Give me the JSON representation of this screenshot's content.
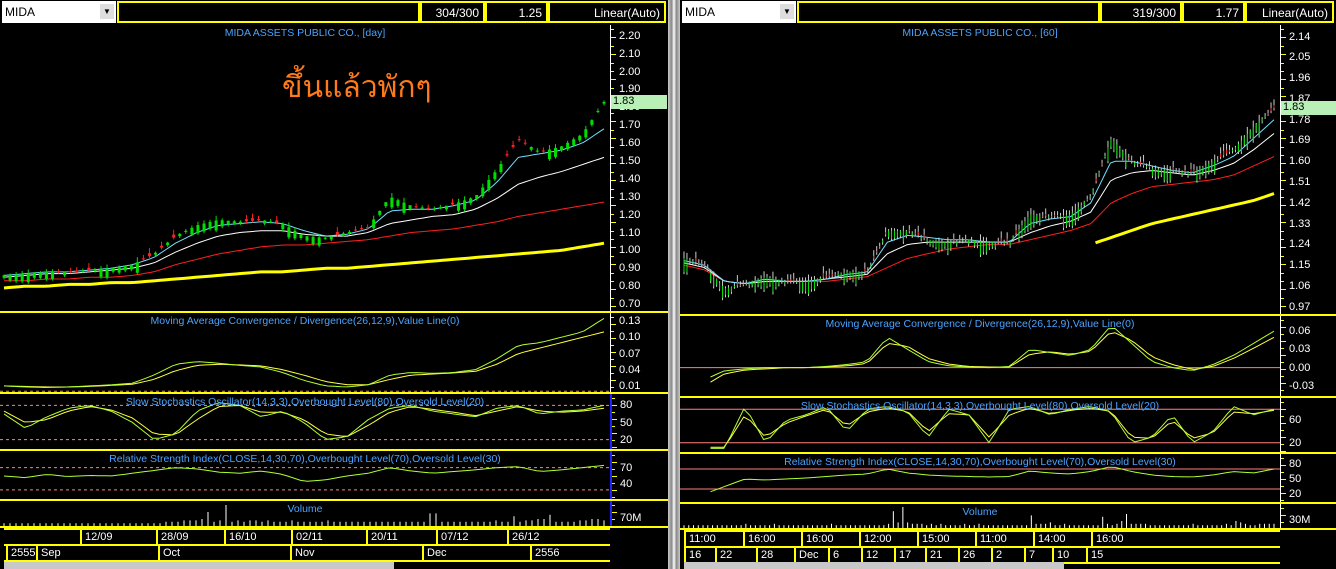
{
  "colors": {
    "grid": "#ffff00",
    "title": "#4aa3ff",
    "up": "#00e000",
    "down": "#ff2020",
    "ema1": "#ffff00",
    "ema2": "#ff2020",
    "ema3": "#ffffff",
    "ema4": "#70e0ff",
    "osc": "#b0ff30",
    "sig": "#ffff40",
    "level": "#ff8080"
  },
  "left": {
    "symbol": "MIDA",
    "counter": "304/300",
    "scale_value": "1.25",
    "scale_mode": "Linear(Auto)",
    "annotation": "ขึ้นแล้วพักๆ",
    "price": {
      "title": "MIDA ASSETS PUBLIC CO., [day]",
      "ylim": [
        0.65,
        2.26
      ],
      "ticks": [
        "2.20",
        "2.10",
        "2.00",
        "1.90",
        "1.80",
        "1.70",
        "1.60",
        "1.50",
        "1.40",
        "1.30",
        "1.20",
        "1.10",
        "1.00",
        "0.90",
        "0.80",
        "0.70"
      ],
      "last": "1.83",
      "close": [
        0.86,
        0.87,
        0.88,
        0.88,
        0.89,
        0.9,
        0.92,
        0.98,
        1.08,
        1.14,
        1.17,
        1.16,
        1.17,
        1.15,
        1.08,
        1.07,
        1.1,
        1.13,
        1.3,
        1.25,
        1.23,
        1.26,
        1.3,
        1.45,
        1.62,
        1.55,
        1.58,
        1.65,
        1.83
      ],
      "ma": [
        [
          0.86,
          0.87,
          0.88,
          0.88,
          0.89,
          0.9,
          0.92,
          0.96,
          1.04,
          1.1,
          1.14,
          1.15,
          1.16,
          1.15,
          1.11,
          1.08,
          1.09,
          1.12,
          1.22,
          1.23,
          1.23,
          1.25,
          1.28,
          1.38,
          1.52,
          1.54,
          1.56,
          1.6,
          1.68
        ],
        [
          0.85,
          0.86,
          0.87,
          0.87,
          0.88,
          0.89,
          0.9,
          0.93,
          0.99,
          1.04,
          1.08,
          1.1,
          1.11,
          1.11,
          1.09,
          1.08,
          1.08,
          1.1,
          1.15,
          1.17,
          1.19,
          1.2,
          1.23,
          1.29,
          1.37,
          1.41,
          1.44,
          1.48,
          1.52
        ],
        [
          0.83,
          0.83,
          0.84,
          0.84,
          0.85,
          0.85,
          0.86,
          0.88,
          0.92,
          0.95,
          0.98,
          1.0,
          1.02,
          1.03,
          1.03,
          1.04,
          1.05,
          1.06,
          1.08,
          1.1,
          1.11,
          1.12,
          1.14,
          1.16,
          1.19,
          1.21,
          1.23,
          1.25,
          1.27
        ],
        [
          0.79,
          0.8,
          0.8,
          0.81,
          0.81,
          0.82,
          0.82,
          0.83,
          0.84,
          0.85,
          0.86,
          0.87,
          0.88,
          0.88,
          0.89,
          0.9,
          0.9,
          0.91,
          0.92,
          0.93,
          0.94,
          0.95,
          0.96,
          0.97,
          0.98,
          0.99,
          1.0,
          1.02,
          1.04
        ]
      ]
    },
    "macd": {
      "title": "Moving Average Convergence / Divergence(26,12,9),Value Line(0)",
      "ylim": [
        -0.005,
        0.145
      ],
      "ticks": [
        "0.13",
        "0.10",
        "0.07",
        "0.04",
        "0.01"
      ],
      "zero": 0,
      "line": [
        0.01,
        0.008,
        0.007,
        0.008,
        0.01,
        0.012,
        0.015,
        0.03,
        0.05,
        0.055,
        0.052,
        0.048,
        0.045,
        0.035,
        0.02,
        0.01,
        0.008,
        0.012,
        0.03,
        0.035,
        0.033,
        0.035,
        0.04,
        0.06,
        0.085,
        0.09,
        0.1,
        0.11,
        0.135
      ],
      "signal": [
        0.01,
        0.009,
        0.008,
        0.008,
        0.009,
        0.011,
        0.013,
        0.022,
        0.038,
        0.048,
        0.05,
        0.049,
        0.047,
        0.04,
        0.03,
        0.018,
        0.012,
        0.012,
        0.022,
        0.03,
        0.032,
        0.034,
        0.037,
        0.05,
        0.07,
        0.08,
        0.09,
        0.1,
        0.11
      ]
    },
    "stoch": {
      "title": "Slow Stochastics Oscillator(14,3,3),Overbought Level(80),Oversold Level(20)",
      "ylim": [
        0,
        100
      ],
      "ticks": [
        "80",
        "50",
        "20"
      ],
      "levels": [
        80,
        20
      ],
      "k": [
        65,
        40,
        60,
        75,
        80,
        70,
        50,
        20,
        30,
        70,
        85,
        80,
        60,
        70,
        50,
        20,
        25,
        55,
        75,
        80,
        70,
        65,
        60,
        75,
        80,
        65,
        70,
        72,
        80
      ],
      "d": [
        70,
        50,
        55,
        70,
        78,
        72,
        58,
        30,
        28,
        55,
        78,
        80,
        68,
        68,
        55,
        30,
        25,
        45,
        68,
        78,
        73,
        68,
        62,
        70,
        78,
        70,
        68,
        70,
        75
      ]
    },
    "rsi": {
      "title": "Relative Strength Index(CLOSE,14,30,70),Overbought Level(70),Oversold Level(30)",
      "ylim": [
        10,
        100
      ],
      "ticks": [
        "70",
        "40"
      ],
      "levels": [
        70,
        30
      ],
      "line": [
        55,
        52,
        58,
        54,
        56,
        55,
        60,
        65,
        70,
        68,
        62,
        60,
        64,
        58,
        45,
        48,
        55,
        60,
        70,
        64,
        60,
        63,
        66,
        70,
        72,
        63,
        66,
        70,
        74
      ]
    },
    "volume": {
      "title": "Volume",
      "ticks": [
        "70M"
      ],
      "bars": [
        2,
        2,
        2,
        2,
        2,
        2,
        2,
        2,
        2,
        2,
        2,
        2,
        2,
        2,
        2,
        2,
        2,
        2,
        2,
        2,
        2,
        2,
        2,
        2,
        2,
        2,
        2,
        3,
        3,
        3,
        4,
        4,
        4,
        5,
        10,
        3,
        4,
        15,
        3,
        4,
        3,
        4,
        4,
        3,
        4,
        3,
        3,
        3,
        4,
        3,
        3,
        3,
        3,
        3,
        4,
        3,
        3,
        3,
        3,
        3,
        3,
        3,
        3,
        3,
        3,
        3,
        3,
        3,
        3,
        3,
        3,
        9,
        9,
        3,
        3,
        3,
        3,
        3,
        3,
        3,
        3,
        3,
        4,
        3,
        3,
        7,
        3,
        4,
        4,
        5,
        5,
        8,
        3,
        3,
        3,
        3,
        4,
        4,
        5,
        5,
        4
      ]
    },
    "dates": [
      "12/09",
      "28/09",
      "16/10",
      "02/11",
      "20/11",
      "07/12",
      "26/12"
    ],
    "months": [
      "2555",
      "Sep",
      "Oct",
      "Nov",
      "Dec",
      "2556"
    ]
  },
  "right": {
    "symbol": "MIDA",
    "counter": "319/300",
    "scale_value": "1.77",
    "scale_mode": "Linear(Auto)",
    "price": {
      "title": "MIDA ASSETS PUBLIC CO., [60]",
      "ylim": [
        0.93,
        2.19
      ],
      "ticks": [
        "2.14",
        "2.05",
        "1.96",
        "1.87",
        "1.78",
        "1.69",
        "1.60",
        "1.51",
        "1.42",
        "1.33",
        "1.24",
        "1.15",
        "1.06",
        "0.97"
      ],
      "last": "1.83",
      "close": [
        1.18,
        1.15,
        1.05,
        1.07,
        1.1,
        1.08,
        1.08,
        1.1,
        1.12,
        1.12,
        1.3,
        1.3,
        1.26,
        1.25,
        1.26,
        1.25,
        1.25,
        1.37,
        1.36,
        1.37,
        1.45,
        1.7,
        1.6,
        1.57,
        1.56,
        1.55,
        1.6,
        1.65,
        1.75,
        1.83
      ],
      "ma": [
        [
          1.17,
          1.15,
          1.08,
          1.07,
          1.09,
          1.08,
          1.08,
          1.09,
          1.11,
          1.12,
          1.25,
          1.28,
          1.27,
          1.26,
          1.26,
          1.25,
          1.25,
          1.33,
          1.35,
          1.36,
          1.42,
          1.6,
          1.6,
          1.58,
          1.56,
          1.55,
          1.58,
          1.62,
          1.7,
          1.78
        ],
        [
          1.16,
          1.14,
          1.08,
          1.07,
          1.08,
          1.08,
          1.08,
          1.09,
          1.1,
          1.11,
          1.2,
          1.24,
          1.25,
          1.25,
          1.25,
          1.25,
          1.25,
          1.29,
          1.32,
          1.34,
          1.38,
          1.52,
          1.55,
          1.56,
          1.55,
          1.54,
          1.56,
          1.59,
          1.65,
          1.72
        ],
        [
          1.15,
          1.13,
          1.08,
          1.07,
          1.08,
          1.08,
          1.08,
          1.08,
          1.09,
          1.1,
          1.14,
          1.18,
          1.2,
          1.22,
          1.23,
          1.24,
          1.24,
          1.26,
          1.28,
          1.3,
          1.33,
          1.42,
          1.46,
          1.49,
          1.5,
          1.51,
          1.52,
          1.54,
          1.58,
          1.62
        ],
        [
          null,
          null,
          null,
          null,
          null,
          null,
          null,
          null,
          null,
          null,
          null,
          null,
          null,
          null,
          null,
          null,
          null,
          null,
          null,
          null,
          1.24,
          1.27,
          1.3,
          1.33,
          1.35,
          1.37,
          1.39,
          1.41,
          1.43,
          1.46
        ]
      ]
    },
    "macd": {
      "title": "Moving Average Convergence / Divergence(26,12,9),Value Line(0)",
      "ylim": [
        -0.05,
        0.085
      ],
      "ticks": [
        "0.06",
        "0.03",
        "0.00",
        "-0.03"
      ],
      "zero": 0,
      "line": [
        null,
        -0.02,
        -0.005,
        -0.002,
        0,
        0,
        0,
        0.002,
        0.005,
        0.01,
        0.05,
        0.03,
        0.01,
        0.003,
        0.001,
        0,
        0.002,
        0.03,
        0.025,
        0.02,
        0.03,
        0.07,
        0.04,
        0.01,
        0.0,
        -0.005,
        0.005,
        0.02,
        0.04,
        0.06
      ],
      "signal": [
        null,
        -0.03,
        -0.01,
        -0.004,
        -0.002,
        0,
        0,
        0.001,
        0.003,
        0.007,
        0.04,
        0.035,
        0.015,
        0.006,
        0.002,
        0.001,
        0.001,
        0.022,
        0.026,
        0.022,
        0.027,
        0.06,
        0.045,
        0.018,
        0.005,
        -0.003,
        0.002,
        0.015,
        0.032,
        0.05
      ]
    },
    "stoch": {
      "title": "Slow Stochastics Oscillator(14,3,3),Overbought Level(80),Oversold Level(20)",
      "ylim": [
        0,
        100
      ],
      "ticks": [
        "60",
        "20"
      ],
      "levels": [
        80,
        20
      ],
      "k": [
        null,
        10,
        10,
        85,
        20,
        60,
        70,
        85,
        40,
        80,
        85,
        75,
        30,
        80,
        70,
        20,
        80,
        85,
        70,
        80,
        85,
        75,
        20,
        30,
        70,
        20,
        40,
        85,
        70,
        80
      ],
      "d": [
        null,
        12,
        12,
        70,
        30,
        55,
        68,
        80,
        50,
        75,
        82,
        76,
        40,
        72,
        70,
        30,
        70,
        82,
        72,
        78,
        82,
        76,
        30,
        28,
        60,
        28,
        38,
        75,
        72,
        78
      ]
    },
    "rsi": {
      "title": "Relative Strength Index(CLOSE,14,30,70),Overbought Level(70),Oversold Level(30)",
      "ylim": [
        0,
        100
      ],
      "ticks": [
        "80",
        "50",
        "20"
      ],
      "levels": [
        70,
        30
      ],
      "line": [
        null,
        20,
        35,
        50,
        48,
        50,
        52,
        55,
        58,
        60,
        70,
        62,
        58,
        56,
        55,
        54,
        55,
        66,
        62,
        60,
        65,
        75,
        65,
        58,
        55,
        54,
        58,
        65,
        62,
        70
      ]
    },
    "volume": {
      "title": "Volume",
      "ticks": [
        "30M"
      ],
      "bars": [
        2,
        2,
        2,
        2,
        2,
        2,
        2,
        2,
        2,
        2,
        2,
        2,
        2,
        3,
        2,
        2,
        2,
        2,
        2,
        3,
        2,
        2,
        2,
        2,
        2,
        2,
        2,
        2,
        2,
        2,
        2,
        3,
        2,
        2,
        2,
        2,
        2,
        2,
        2,
        2,
        2,
        2,
        2,
        3,
        12,
        4,
        15,
        4,
        3,
        3,
        3,
        2,
        3,
        2,
        3,
        2,
        2,
        2,
        2,
        3,
        2,
        2,
        3,
        2,
        2,
        2,
        2,
        2,
        2,
        2,
        2,
        2,
        2,
        9,
        3,
        3,
        3,
        4,
        2,
        2,
        3,
        2,
        2,
        2,
        2,
        2,
        2,
        2,
        8,
        3,
        2,
        3,
        5,
        10,
        3,
        3,
        3,
        3,
        2,
        2,
        2,
        2,
        2,
        2,
        2,
        2,
        2,
        3,
        2,
        2,
        2,
        2,
        2,
        2,
        3,
        2,
        5,
        4,
        3,
        2,
        2,
        3,
        3,
        3,
        3
      ]
    },
    "dates": [
      "11:00",
      "16:00",
      "16:00",
      "12:00",
      "15:00",
      "11:00",
      "14:00",
      "16:00"
    ],
    "days": [
      "16",
      "22",
      "28",
      "Dec",
      "6",
      "12",
      "17",
      "21",
      "26",
      "2",
      "7",
      "10",
      "15"
    ]
  }
}
